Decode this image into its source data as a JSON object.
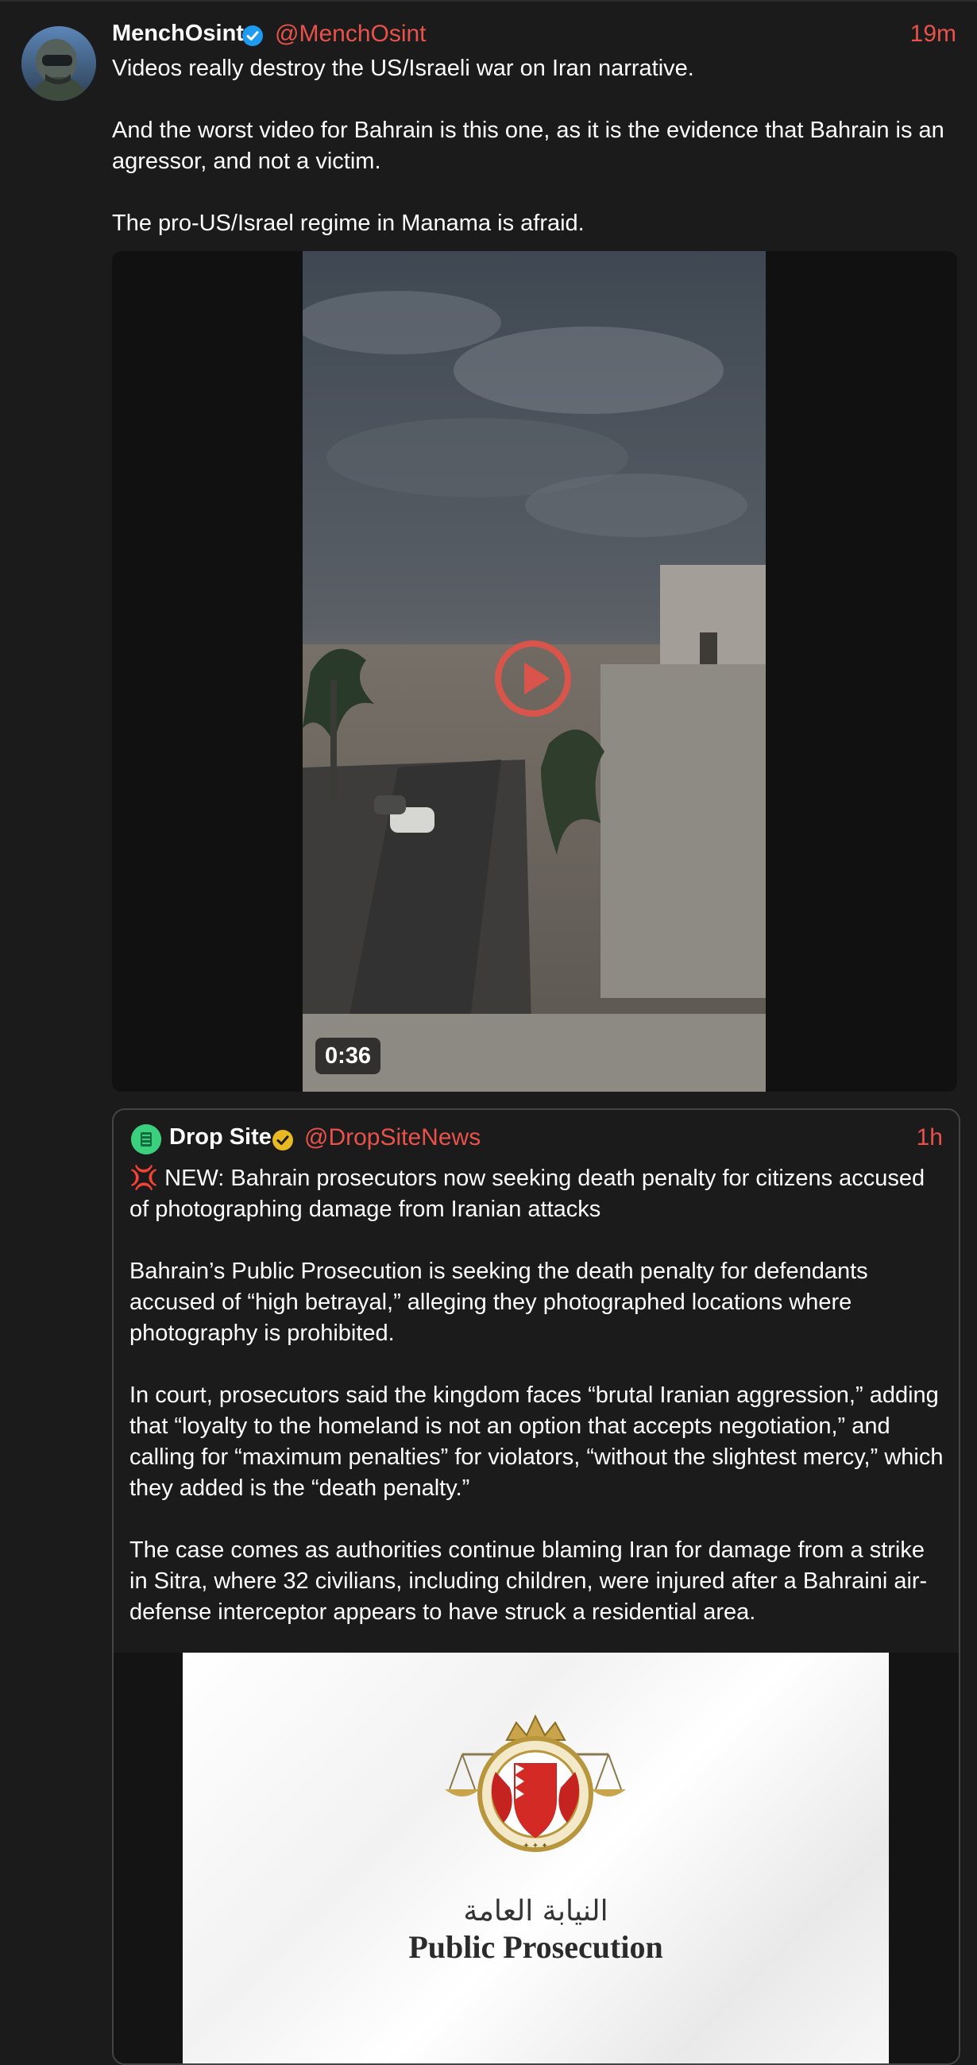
{
  "post": {
    "author_name": "MenchOsint",
    "handle": "@MenchOsint",
    "time": "19m",
    "paragraphs": [
      "Videos really destroy the US/Israeli war on Iran narrative.",
      "And the worst video for Bahrain is this one, as it is the evidence that Bahrain is an agressor, and not a victim.",
      "The pro-US/Israel regime in Manama is afraid."
    ],
    "video": {
      "duration": "0:36"
    }
  },
  "quote": {
    "author_name": "Drop Site",
    "handle": "@DropSiteNews",
    "time": "1h",
    "badge_emoji": "💢",
    "paragraphs": [
      "NEW: Bahrain prosecutors now seeking death penalty for citizens accused of photographing damage from Iranian attacks",
      "Bahrain’s Public Prosecution is seeking the death penalty for defendants accused of “high betrayal,” alleging they photographed locations where photography is prohibited.",
      "In court, prosecutors said the kingdom faces “brutal Iranian aggression,” adding that “loyalty to the homeland is not an option that accepts negotiation,” and calling for “maximum penalties” for violators, “without the slightest mercy,” which they added is the “death penalty.”",
      "The case comes as authorities continue blaming Iran for damage from a strike in Sitra, where 32 civilians, including children, were injured after a Bahraini air-defense interceptor appears to have struck a residential area."
    ],
    "image": {
      "arabic_text": "النيابة العامة",
      "english_text": "Public Prosecution"
    }
  },
  "colors": {
    "background": "#1b1b1b",
    "accent": "#e8524a",
    "verified_blue": "#1d9bf0",
    "verified_gold": "#e8b923"
  }
}
